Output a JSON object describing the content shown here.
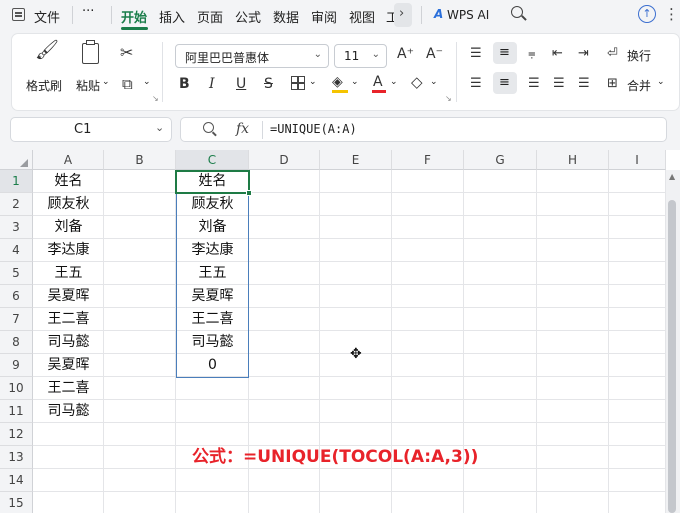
{
  "menu": {
    "file": "文件",
    "more": "···",
    "tabs": [
      "开始",
      "插入",
      "页面",
      "公式",
      "数据",
      "审阅",
      "视图"
    ],
    "cut_tab": "工",
    "wps_ai": "WPS AI"
  },
  "ribbon": {
    "format_painter": "格式刷",
    "paste": "粘贴",
    "font_name": "阿里巴巴普惠体",
    "font_size": "11",
    "bold": "B",
    "italic": "I",
    "underline": "U",
    "wrap_text": "换行",
    "merge": "合并"
  },
  "formula_bar": {
    "name_box": "C1",
    "fx": "fx",
    "formula": "=UNIQUE(A:A)"
  },
  "columns": [
    "A",
    "B",
    "C",
    "D",
    "E",
    "F",
    "G",
    "H",
    "I"
  ],
  "rows": [
    "1",
    "2",
    "3",
    "4",
    "5",
    "6",
    "7",
    "8",
    "9",
    "10",
    "11",
    "12",
    "13",
    "14",
    "15"
  ],
  "column_a": [
    "姓名",
    "顾友秋",
    "刘备",
    "李达康",
    "王五",
    "吴夏晖",
    "王二喜",
    "司马懿",
    "吴夏晖",
    "王二喜",
    "司马懿"
  ],
  "column_c": [
    "姓名",
    "顾友秋",
    "刘备",
    "李达康",
    "王五",
    "吴夏晖",
    "王二喜",
    "司马懿",
    "0"
  ],
  "annotation": "公式：=UNIQUE(TOCOL(A:A,3))",
  "colors": {
    "accent_green": "#1a7d4a",
    "annotation_red": "#e8232a",
    "spill_blue": "#4a7ebb"
  }
}
